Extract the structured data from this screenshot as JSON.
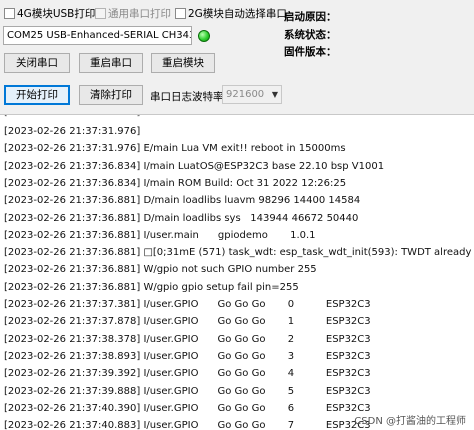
{
  "toolbar": {
    "checkbox_4g": "4G模块USB打印",
    "checkbox_general": "通用串口打印",
    "checkbox_2g": "2G模块自动选择串口",
    "port_select": "COM25 USB-Enhanced-SERIAL CH343 (",
    "close_port": "关闭串口",
    "restart_port": "重启串口",
    "restart_module": "重启模块",
    "start_print": "开始打印",
    "clear_print": "清除打印",
    "baud_label": "串口日志波特率",
    "baud_value": "921600",
    "boot_reason_label": "启动原因：",
    "system_status_label": "系统状态：",
    "firmware_version_label": "固件版本："
  },
  "log": {
    "partial_top": "[2023-02-26 21:37:31.976]   ...                  ...",
    "lines": [
      "[2023-02-26 21:37:31.976]",
      "[2023-02-26 21:37:31.976] E/main Lua VM exit!! reboot in 15000ms",
      "[2023-02-26 21:37:36.834] I/main LuatOS@ESP32C3 base 22.10 bsp V1001",
      "[2023-02-26 21:37:36.834] I/main ROM Build: Oct 31 2022 12:26:25",
      "[2023-02-26 21:37:36.881] D/main loadlibs luavm 98296 14400 14584",
      "[2023-02-26 21:37:36.881] D/main loadlibs sys   143944 46672 50440",
      "[2023-02-26 21:37:36.881] I/user.main      gpiodemo       1.0.1",
      "[2023-02-26 21:37:36.881] □[0;31mE (571) task_wdt: esp_task_wdt_init(593): TWDT already initialized□[0m",
      "[2023-02-26 21:37:36.881] W/gpio not such GPIO number 255",
      "[2023-02-26 21:37:36.881] W/gpio gpio setup fail pin=255",
      "[2023-02-26 21:37:37.381] I/user.GPIO      Go Go Go       0          ESP32C3",
      "[2023-02-26 21:37:37.878] I/user.GPIO      Go Go Go       1          ESP32C3",
      "[2023-02-26 21:37:38.378] I/user.GPIO      Go Go Go       2          ESP32C3",
      "[2023-02-26 21:37:38.893] I/user.GPIO      Go Go Go       3          ESP32C3",
      "[2023-02-26 21:37:39.392] I/user.GPIO      Go Go Go       4          ESP32C3",
      "[2023-02-26 21:37:39.888] I/user.GPIO      Go Go Go       5          ESP32C3",
      "[2023-02-26 21:37:40.390] I/user.GPIO      Go Go Go       6          ESP32C3",
      "[2023-02-26 21:37:40.883] I/user.GPIO      Go Go Go       7          ESP32C3"
    ]
  },
  "watermark": "CSDN @打酱油的工程师"
}
